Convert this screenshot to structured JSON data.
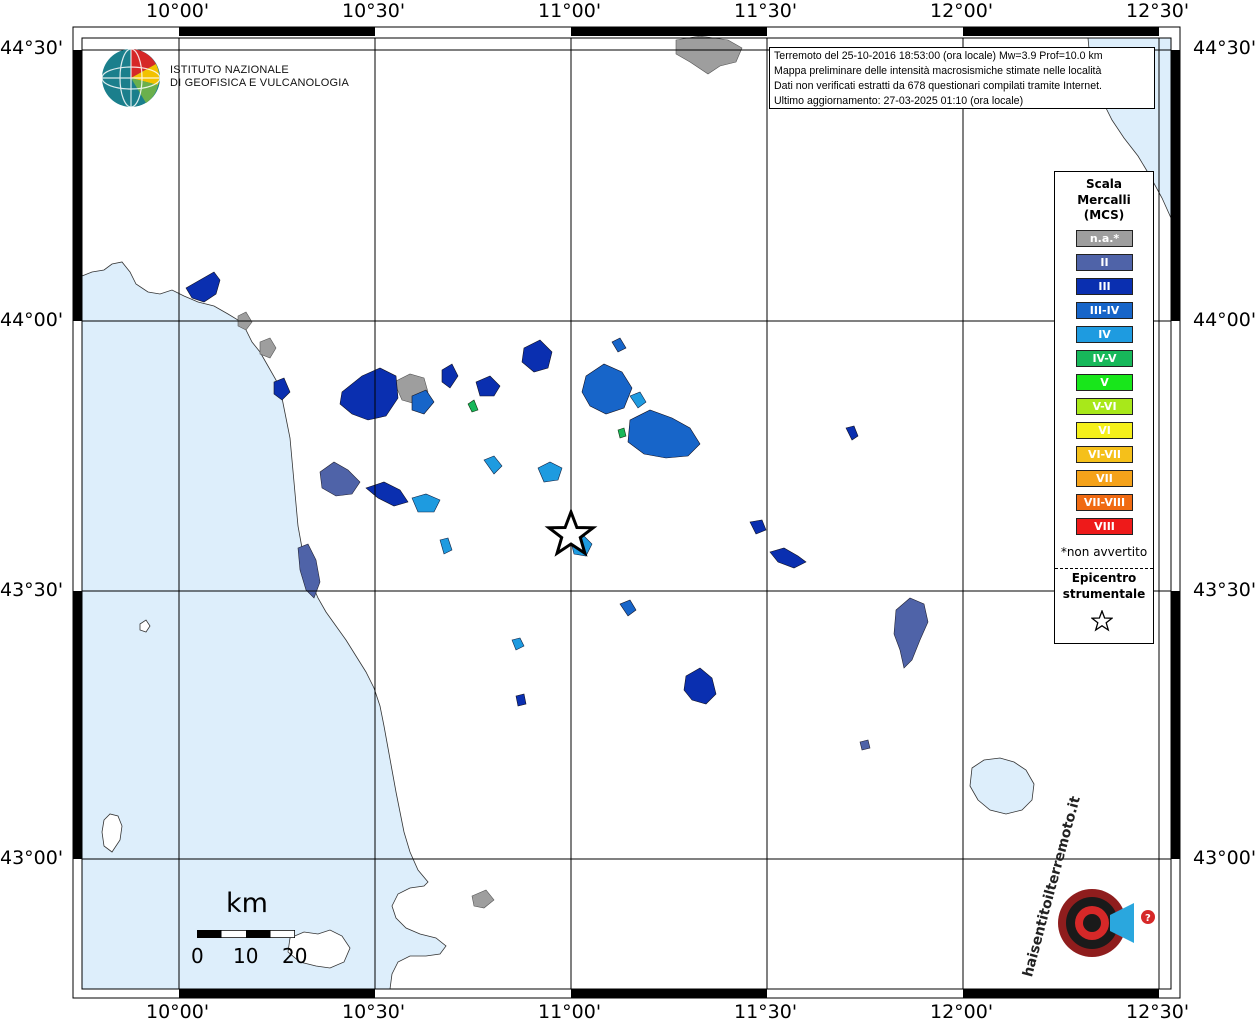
{
  "info": {
    "line1": "Terremoto del 25-10-2016 18:53:00 (ora locale) Mw=3.9 Prof=10.0 km",
    "line2": "Mappa preliminare delle intensità macrosismiche stimate nelle località",
    "line3": "Dati non verificati estratti da 678 questionari compilati tramite Internet.",
    "line4": "Ultimo aggiornamento: 27-03-2025 01:10 (ora locale)"
  },
  "institute": {
    "line1": "ISTITUTO NAZIONALE",
    "line2": "DI GEOFISICA E VULCANOLOGIA"
  },
  "axes": {
    "top": [
      "10°00'",
      "10°30'",
      "11°00'",
      "11°30'",
      "12°00'",
      "12°30'"
    ],
    "bottom": [
      "10°00'",
      "10°30'",
      "11°00'",
      "11°30'",
      "12°00'",
      "12°30'"
    ],
    "left": [
      "44°30'",
      "44°00'",
      "43°30'",
      "43°00'"
    ],
    "right": [
      "44°30'",
      "44°00'",
      "43°30'",
      "43°00'"
    ]
  },
  "legend": {
    "title": [
      "Scala",
      "Mercalli",
      "(MCS)"
    ],
    "items": [
      {
        "label": "n.a.*",
        "color": "#9e9e9e"
      },
      {
        "label": "II",
        "color": "#4f63a8"
      },
      {
        "label": "III",
        "color": "#0a2fb0"
      },
      {
        "label": "III-IV",
        "color": "#1765c9"
      },
      {
        "label": "IV",
        "color": "#1e9be0"
      },
      {
        "label": "IV-V",
        "color": "#17b85a"
      },
      {
        "label": "V",
        "color": "#18e61b"
      },
      {
        "label": "V-VI",
        "color": "#a8e81a"
      },
      {
        "label": "VI",
        "color": "#f5f01a"
      },
      {
        "label": "VI-VII",
        "color": "#f5c01a"
      },
      {
        "label": "VII",
        "color": "#f5a21a"
      },
      {
        "label": "VII-VIII",
        "color": "#f06a12"
      },
      {
        "label": "VIII",
        "color": "#ee1a1a"
      }
    ],
    "note": "*non avvertito",
    "epicenter": [
      "Epicentro",
      "strumentale"
    ]
  },
  "scale": {
    "unit": "km",
    "ticks": [
      "0",
      "10",
      "20"
    ]
  },
  "logo_text": "haisentitoilterremoto.it",
  "colors": {
    "sea": "#ddeefb",
    "land": "#ffffff",
    "frame": "#000000"
  }
}
